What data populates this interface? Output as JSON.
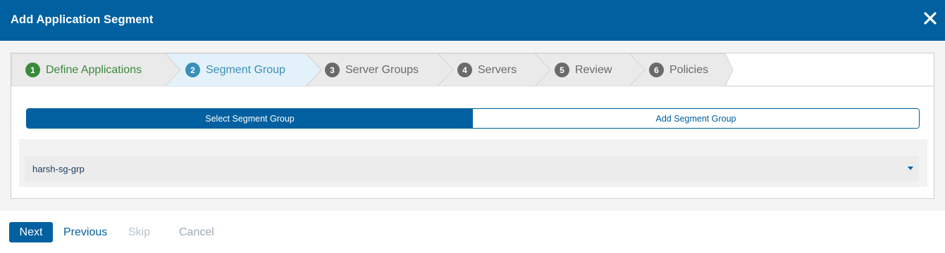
{
  "dialog": {
    "title": "Add Application Segment",
    "close_icon": "close-icon"
  },
  "steps": [
    {
      "num": "1",
      "label": "Define Applications",
      "state": "completed"
    },
    {
      "num": "2",
      "label": "Segment Group",
      "state": "active"
    },
    {
      "num": "3",
      "label": "Server Groups",
      "state": "pending"
    },
    {
      "num": "4",
      "label": "Servers",
      "state": "pending"
    },
    {
      "num": "5",
      "label": "Review",
      "state": "pending"
    },
    {
      "num": "6",
      "label": "Policies",
      "state": "pending"
    }
  ],
  "segment_toggle": {
    "select_label": "Select Segment Group",
    "add_label": "Add Segment Group",
    "selected": "Select Segment Group"
  },
  "segment_select": {
    "value": "harsh-sg-grp"
  },
  "footer": {
    "next_label": "Next",
    "previous_label": "Previous",
    "skip_label": "Skip",
    "cancel_label": "Cancel"
  },
  "colors": {
    "primary": "#0060a0",
    "completed": "#3a8a3a",
    "active": "#3a8fb8",
    "pending": "#6a6a6a"
  }
}
